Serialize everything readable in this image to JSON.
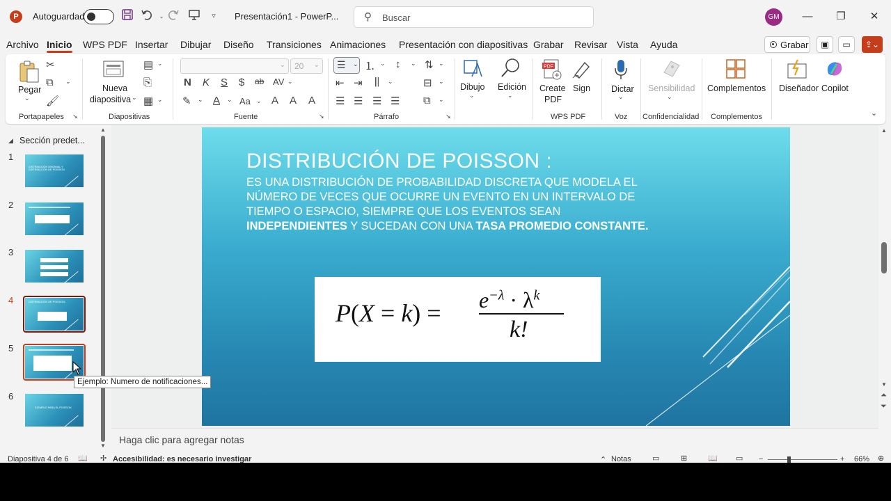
{
  "titlebar": {
    "app_logo": "P",
    "autosave_label": "Autoguardado",
    "autosave_state": "off",
    "doc_title": "Presentación1  -  PowerP...",
    "search_placeholder": "Buscar",
    "avatar_initials": "GM",
    "icons": [
      "save-icon",
      "undo-icon",
      "redo-icon",
      "present-icon",
      "customize-icon"
    ]
  },
  "menu": {
    "items": [
      "Archivo",
      "Inicio",
      "WPS PDF",
      "Insertar",
      "Dibujar",
      "Diseño",
      "Transiciones",
      "Animaciones",
      "Presentación con diapositivas",
      "Grabar",
      "Revisar",
      "Vista",
      "Ayuda"
    ],
    "active": "Inicio",
    "record_button": "Grabar"
  },
  "ribbon": {
    "paste": "Pegar",
    "new_slide_line1": "Nueva",
    "new_slide_line2": "diapositiva",
    "font_name": "",
    "font_size": "20",
    "draw": "Dibujo",
    "edit": "Edición",
    "create_pdf_line1": "Create",
    "create_pdf_line2": "PDF",
    "sign": "Sign",
    "dictate": "Dictar",
    "sensitivity": "Sensibilidad",
    "addins": "Complementos",
    "designer": "Diseñador",
    "copilot": "Copilot",
    "groups": {
      "clipboard": "Portapapeles",
      "slides": "Diapositivas",
      "font": "Fuente",
      "paragraph": "Párrafo",
      "wps_pdf": "WPS PDF",
      "voice": "Voz",
      "confidentiality": "Confidencialidad",
      "addins": "Complementos"
    },
    "font_buttons": [
      "N",
      "K",
      "S",
      "$",
      "ab",
      "AV",
      "A",
      "Aa",
      "A",
      "A",
      "A"
    ]
  },
  "slide_panel": {
    "section": "Sección predet...",
    "thumbnails": [
      {
        "num": "1",
        "text": "DISTRIBUCIÓN BINOMIAL Y DISTRIBUCIÓN DE POISSON"
      },
      {
        "num": "2",
        "text": ""
      },
      {
        "num": "3",
        "text": ""
      },
      {
        "num": "4",
        "text": "DISTRIBUCIÓN DE POISSON :"
      },
      {
        "num": "5",
        "text": ""
      },
      {
        "num": "6",
        "text": "EJEMPLO PARA EL POISSON"
      }
    ],
    "active_slide": "4",
    "tooltip": "Ejemplo:  Numero de notificaciones..."
  },
  "slide": {
    "title": "DISTRIBUCIÓN DE POISSON :",
    "body_part1": "ES UNA DISTRIBUCIÓN DE PROBABILIDAD DISCRETA QUE MODELA EL NÚMERO DE VECES QUE OCURRE UN EVENTO EN UN INTERVALO DE TIEMPO O ESPACIO, SIEMPRE QUE LOS EVENTOS SEAN ",
    "body_bold1": "INDEPENDIENTES",
    "body_part2": " Y SUCEDAN CON UNA ",
    "body_bold2": "TASA PROMEDIO CONSTANTE.",
    "formula": {
      "lhs": "P(X = k) =",
      "numerator_base": "e",
      "numerator_exp": "−λ",
      "numerator_mid": " · λ",
      "numerator_exp2": "k",
      "denominator": "k!"
    }
  },
  "notes": {
    "placeholder": "Haga clic para agregar notas"
  },
  "statusbar": {
    "slide_info": "Diapositiva 4 de 6",
    "accessibility": "Accesibilidad: es necesario investigar",
    "notes": "Notas",
    "zoom": "66%"
  },
  "colors": {
    "accent": "#c43e1c",
    "slide_top": "#6ddceb",
    "slide_bottom": "#1f74a0"
  }
}
